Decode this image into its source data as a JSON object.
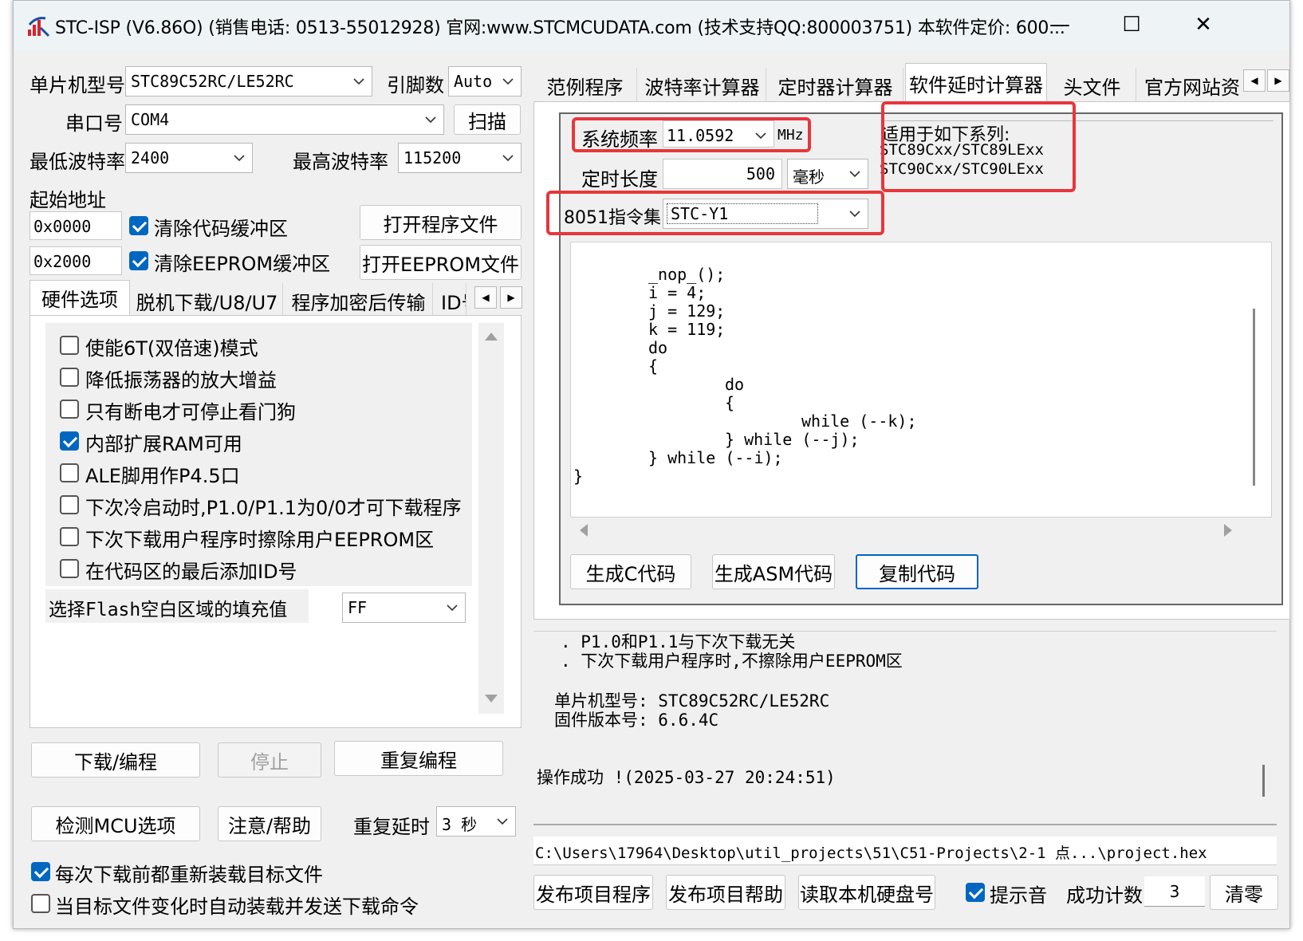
{
  "window": {
    "title": "STC-ISP (V6.86O) (销售电话: 0513-55012928) 官网:www.STCMCUDATA.com  (技术支持QQ:800003751) 本软件定价: 600...",
    "minimize_glyph": "—",
    "maximize_glyph": "☐",
    "close_glyph": "✕"
  },
  "left": {
    "mcu_label": "单片机型号",
    "mcu_value": "STC89C52RC/LE52RC",
    "pins_label": "引脚数",
    "pins_value": "Auto",
    "port_label": "串口号",
    "port_value": "COM4",
    "scan_button": "扫描",
    "min_baud_label": "最低波特率",
    "min_baud_value": "2400",
    "max_baud_label": "最高波特率",
    "max_baud_value": "115200",
    "start_addr_label": "起始地址",
    "code_addr": "0x0000",
    "clear_code_label": "清除代码缓冲区",
    "open_program_button": "打开程序文件",
    "eeprom_addr": "0x2000",
    "clear_eeprom_label": "清除EEPROM缓冲区",
    "open_eeprom_button": "打开EEPROM文件",
    "tabs": [
      "硬件选项",
      "脱机下载/U8/U7",
      "程序加密后传输",
      "ID号"
    ],
    "options": [
      {
        "label": "使能6T(双倍速)模式",
        "checked": false
      },
      {
        "label": "降低振荡器的放大增益",
        "checked": false
      },
      {
        "label": "只有断电才可停止看门狗",
        "checked": false
      },
      {
        "label": "内部扩展RAM可用",
        "checked": true
      },
      {
        "label": "ALE脚用作P4.5口",
        "checked": false
      },
      {
        "label": "下次冷启动时,P1.0/P1.1为0/0才可下载程序",
        "checked": false
      },
      {
        "label": "下次下载用户程序时擦除用户EEPROM区",
        "checked": false
      },
      {
        "label": "在代码区的最后添加ID号",
        "checked": false
      }
    ],
    "fill_label": "选择Flash空白区域的填充值",
    "fill_value": "FF",
    "download_button": "下载/编程",
    "stop_button": "停止",
    "reprogram_button": "重复编程",
    "detect_button": "检测MCU选项",
    "help_button": "注意/帮助",
    "repeat_delay_label": "重复延时",
    "repeat_delay_value": "3 秒",
    "reload_label": "每次下载前都重新装载目标文件",
    "auto_send_label": "当目标文件变化时自动装载并发送下载命令"
  },
  "right": {
    "tabs": [
      "范例程序",
      "波特率计算器",
      "定时器计算器",
      "软件延时计算器",
      "头文件",
      "官方网站资"
    ],
    "freq_label": "系统频率",
    "freq_value": "11.0592",
    "freq_unit": "MHz",
    "duration_label": "定时长度",
    "duration_value": "500",
    "duration_unit": "毫秒",
    "isa_label": "8051指令集",
    "isa_value": "STC-Y1",
    "series_title": "适用于如下系列:",
    "series_1": "STC89Cxx/STC89LExx",
    "series_2": "STC90Cxx/STC90LExx",
    "code_lines": [
      "_nop_();",
      "i = 4;",
      "j = 129;",
      "k = 119;",
      "do",
      "{",
      "do",
      "{",
      "while (--k);",
      "} while (--j);",
      "} while (--i);",
      "}"
    ],
    "gen_c_button": "生成C代码",
    "gen_asm_button": "生成ASM代码",
    "copy_button": "复制代码"
  },
  "log": {
    "line1": ". P1.0和P1.1与下次下载无关",
    "line2": ". 下次下载用户程序时,不擦除用户EEPROM区",
    "mcu_line": "单片机型号: STC89C52RC/LE52RC",
    "fw_line": "固件版本号: 6.6.4C",
    "success_line": "操作成功 !(2025-03-27 20:24:51)"
  },
  "bottom": {
    "path": "C:\\Users\\17964\\Desktop\\util_projects\\51\\C51-Projects\\2-1 点...\\project.hex",
    "publish_program_button": "发布项目程序",
    "publish_help_button": "发布项目帮助",
    "read_disk_button": "读取本机硬盘号",
    "sound_label": "提示音",
    "success_count_label": "成功计数",
    "success_count_value": "3",
    "clear_button": "清零"
  },
  "colors": {
    "accent": "#0067c0",
    "highlight": "#e8363b",
    "logo": "#d9232d"
  }
}
